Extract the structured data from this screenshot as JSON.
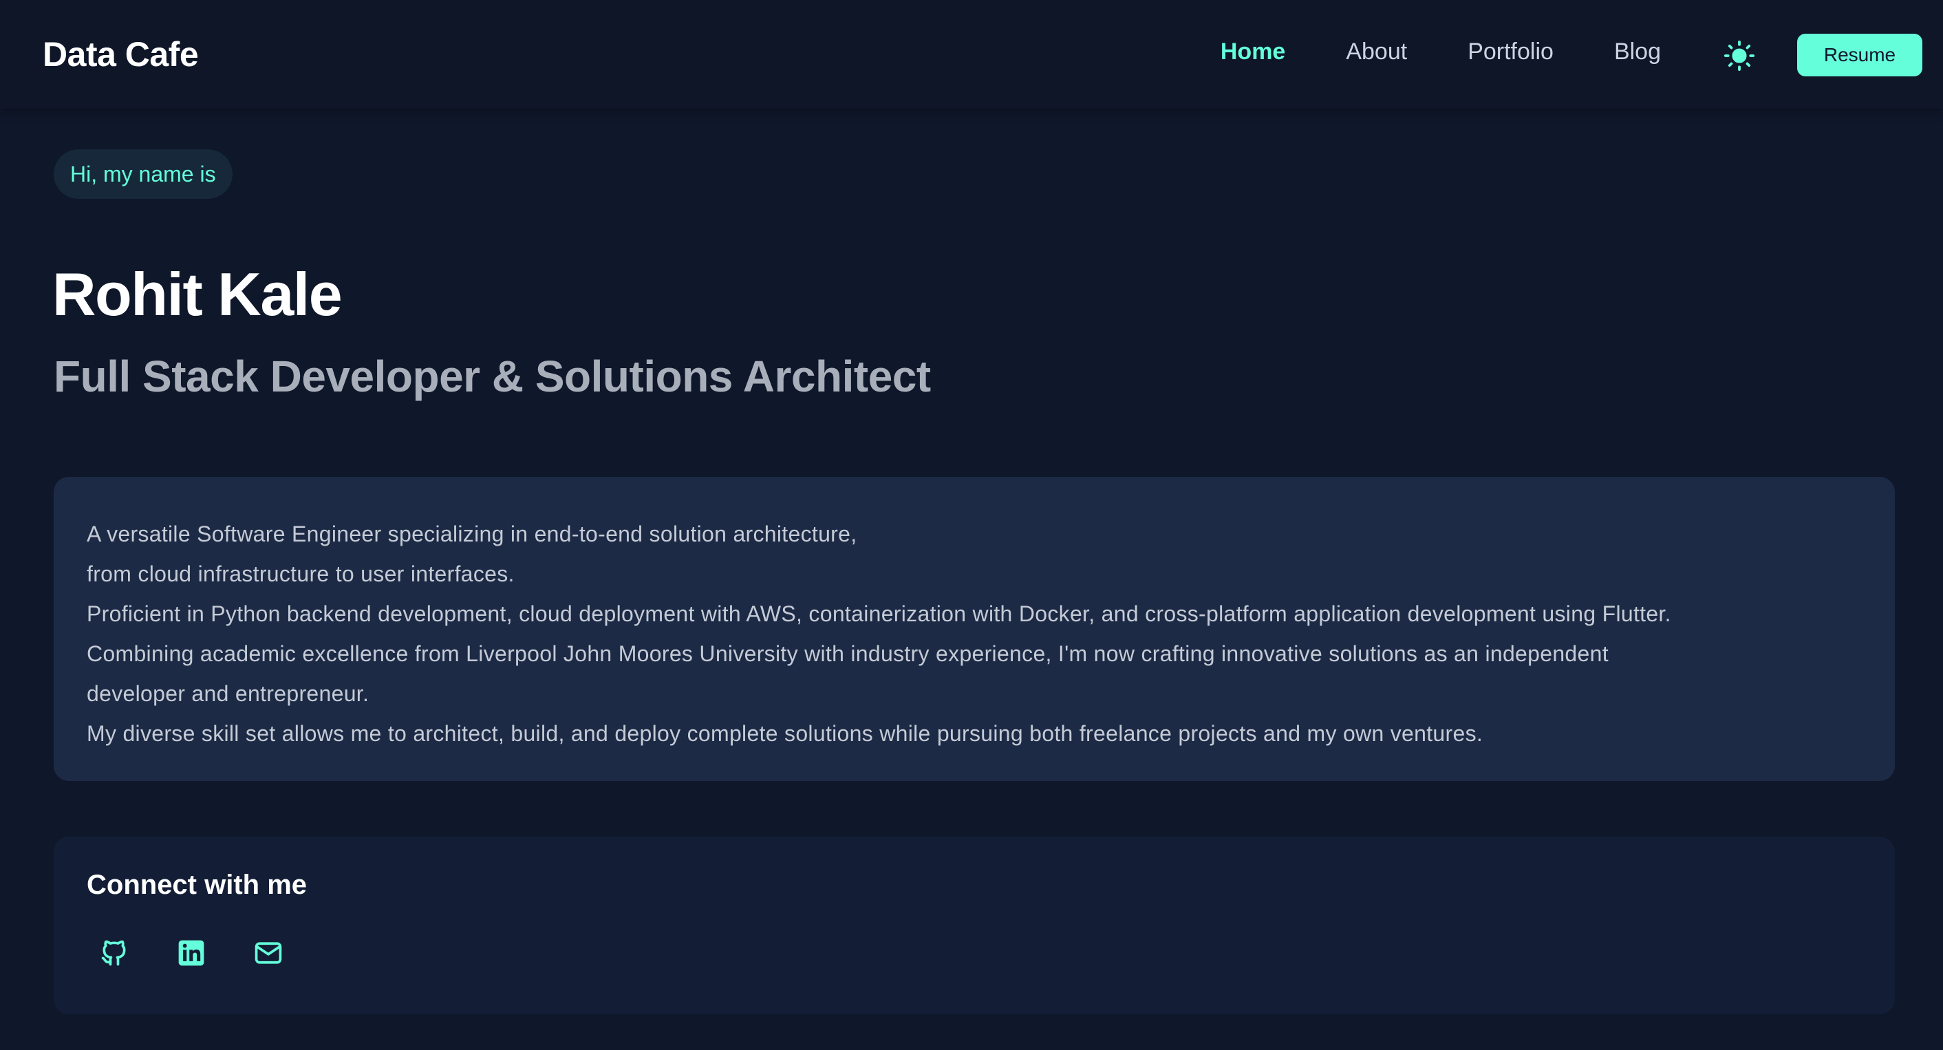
{
  "navbar": {
    "brand": "Data Cafe",
    "links": [
      {
        "label": "Home",
        "active": true
      },
      {
        "label": "About",
        "active": false
      },
      {
        "label": "Portfolio",
        "active": false
      },
      {
        "label": "Blog",
        "active": false
      }
    ],
    "theme_toggle_icon": "sun-icon",
    "resume_label": "Resume"
  },
  "hero": {
    "greeting": "Hi, my name is",
    "name": "Rohit Kale",
    "title": "Full Stack Developer & Solutions Architect"
  },
  "bio": {
    "lines": [
      "A versatile Software Engineer specializing in end-to-end solution architecture,",
      "from cloud infrastructure to user interfaces.",
      "Proficient in Python backend development, cloud deployment with AWS, containerization with Docker, and cross-platform application development using Flutter.",
      "Combining academic excellence from Liverpool John Moores University with industry experience, I'm now crafting innovative solutions as an independent",
      "developer and entrepreneur.",
      "My diverse skill set allows me to architect, build, and deploy complete solutions while pursuing both freelance projects and my own ventures."
    ]
  },
  "connect": {
    "title": "Connect with me",
    "links": [
      {
        "icon": "github-icon"
      },
      {
        "icon": "linkedin-icon"
      },
      {
        "icon": "mail-icon"
      }
    ]
  },
  "colors": {
    "background": "#0f172a",
    "accent": "#64ffda",
    "card": "#1d2a45",
    "muted_text": "#a8afba"
  }
}
